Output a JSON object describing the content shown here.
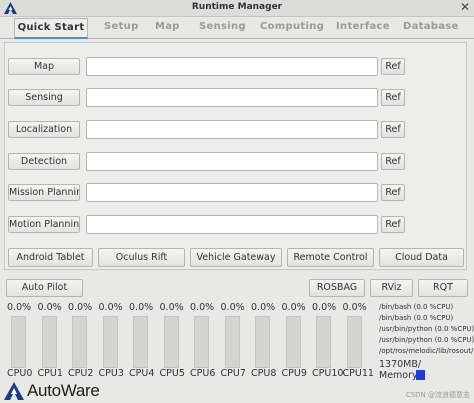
{
  "window": {
    "title": "Runtime Manager",
    "close_glyph": "✕"
  },
  "tabs": [
    "Quick Start",
    "Setup",
    "Map",
    "Sensing",
    "Computing",
    "Interface",
    "Database"
  ],
  "quick_start": {
    "rows": [
      {
        "label": "Map",
        "ref": "Ref",
        "value": ""
      },
      {
        "label": "Sensing",
        "ref": "Ref",
        "value": ""
      },
      {
        "label": "Localization",
        "ref": "Ref",
        "value": ""
      },
      {
        "label": "Detection",
        "ref": "Ref",
        "value": ""
      },
      {
        "label": "Mission Planning",
        "ref": "Ref",
        "value": ""
      },
      {
        "label": "Motion Planning",
        "ref": "Ref",
        "value": ""
      }
    ],
    "action_buttons": [
      "Android Tablet",
      "Oculus Rift",
      "Vehicle Gateway",
      "Remote Control",
      "Cloud Data"
    ]
  },
  "bottom_buttons": {
    "auto_pilot": "Auto Pilot",
    "rosbag": "ROSBAG",
    "rviz": "RViz",
    "rqt": "RQT"
  },
  "cpus": [
    {
      "name": "CPU0",
      "pct": "0.0%",
      "level": 0
    },
    {
      "name": "CPU1",
      "pct": "0.0%",
      "level": 0
    },
    {
      "name": "CPU2",
      "pct": "0.0%",
      "level": 0
    },
    {
      "name": "CPU3",
      "pct": "0.0%",
      "level": 0
    },
    {
      "name": "CPU4",
      "pct": "0.0%",
      "level": 0
    },
    {
      "name": "CPU5",
      "pct": "0.0%",
      "level": 0
    },
    {
      "name": "CPU6",
      "pct": "0.0%",
      "level": 0
    },
    {
      "name": "CPU7",
      "pct": "0.0%",
      "level": 0
    },
    {
      "name": "CPU8",
      "pct": "0.0%",
      "level": 0
    },
    {
      "name": "CPU9",
      "pct": "0.0%",
      "level": 0
    },
    {
      "name": "CPU10",
      "pct": "0.0%",
      "level": 0
    },
    {
      "name": "CPU11",
      "pct": "0.0%",
      "level": 0
    }
  ],
  "processes": [
    "/bin/bash (0.0 %CPU)",
    "/bin/bash (0.0 %CPU)",
    "/usr/bin/python (0.0 %CPU)",
    "/usr/bin/python (0.0 %CPU)",
    "/opt/ros/melodic/lib/rosout/rosout"
  ],
  "memory": {
    "used": "1370MB/",
    "label": "Memory"
  },
  "brand": {
    "name": "AutoWare"
  },
  "watermark": "CSDN @流浪德意志",
  "colors": {
    "accent": "#4a90d9",
    "memory_bar": "#1e3fd6",
    "logo_blue": "#1a3a8c"
  }
}
